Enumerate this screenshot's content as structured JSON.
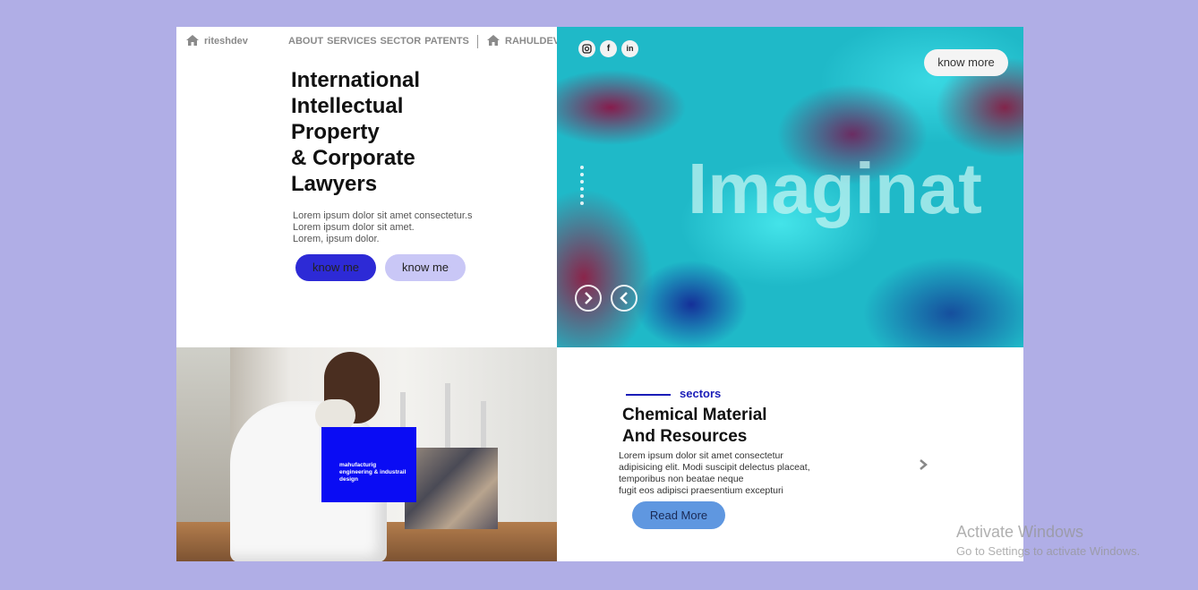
{
  "nav": {
    "brand_left": "riteshdev",
    "links": [
      "ABOUT",
      "SERVICES",
      "SECTOR",
      "PATENTS"
    ],
    "brand_right": "RAHULDEV"
  },
  "hero": {
    "title_lines": [
      "International",
      "Intellectual",
      "Property",
      "& Corporate",
      "Lawyers"
    ],
    "description_lines": [
      "Lorem ipsum dolor sit amet consectetur.s",
      "Lorem ipsum dolor sit amet.",
      "Lorem, ipsum dolor."
    ],
    "button_primary": "know me",
    "button_secondary": "know me",
    "colors": {
      "primary_button": "#2d2ad6",
      "secondary_button": "#c9c7f6"
    }
  },
  "slider": {
    "social_icons": [
      "instagram-icon",
      "facebook-icon",
      "linkedin-icon"
    ],
    "know_more": "know more",
    "overlay_word": "Imaginat",
    "nav_icons": [
      "next-circle-icon",
      "prev-circle-icon"
    ]
  },
  "industry_tile": {
    "caption_lines": [
      "mahufacturig",
      "engineering & industrail",
      "design"
    ],
    "color": "#0a0cf4"
  },
  "sectors": {
    "label": "sectors",
    "title_lines": [
      "Chemical Material",
      "And Resources"
    ],
    "description_lines": [
      "Lorem ipsum dolor sit amet consectetur",
      "adipisicing elit. Modi suscipit delectus placeat,",
      "temporibus non beatae neque",
      "fugit eos adipisci praesentium excepturi"
    ],
    "read_more": "Read More",
    "accent_color": "#1a1db8"
  },
  "watermark": {
    "title": "Activate Windows",
    "subtitle": "Go to Settings to activate Windows."
  },
  "page": {
    "background": "#b0aee6"
  }
}
